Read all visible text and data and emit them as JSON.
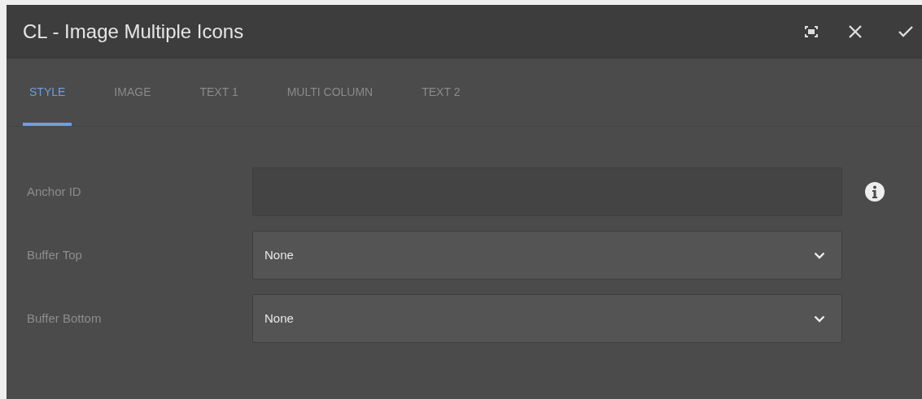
{
  "window": {
    "title": "CL - Image Multiple Icons"
  },
  "tabs": [
    {
      "label": "STYLE",
      "selected": true
    },
    {
      "label": "IMAGE",
      "selected": false
    },
    {
      "label": "TEXT 1",
      "selected": false
    },
    {
      "label": "MULTI COLUMN",
      "selected": false
    },
    {
      "label": "TEXT 2",
      "selected": false
    }
  ],
  "fields": [
    {
      "kind": "text",
      "label": "Anchor ID",
      "info": true
    },
    {
      "kind": "select",
      "label": "Buffer Top",
      "value": "None"
    },
    {
      "kind": "select",
      "label": "Buffer Bottom",
      "value": "None"
    }
  ]
}
